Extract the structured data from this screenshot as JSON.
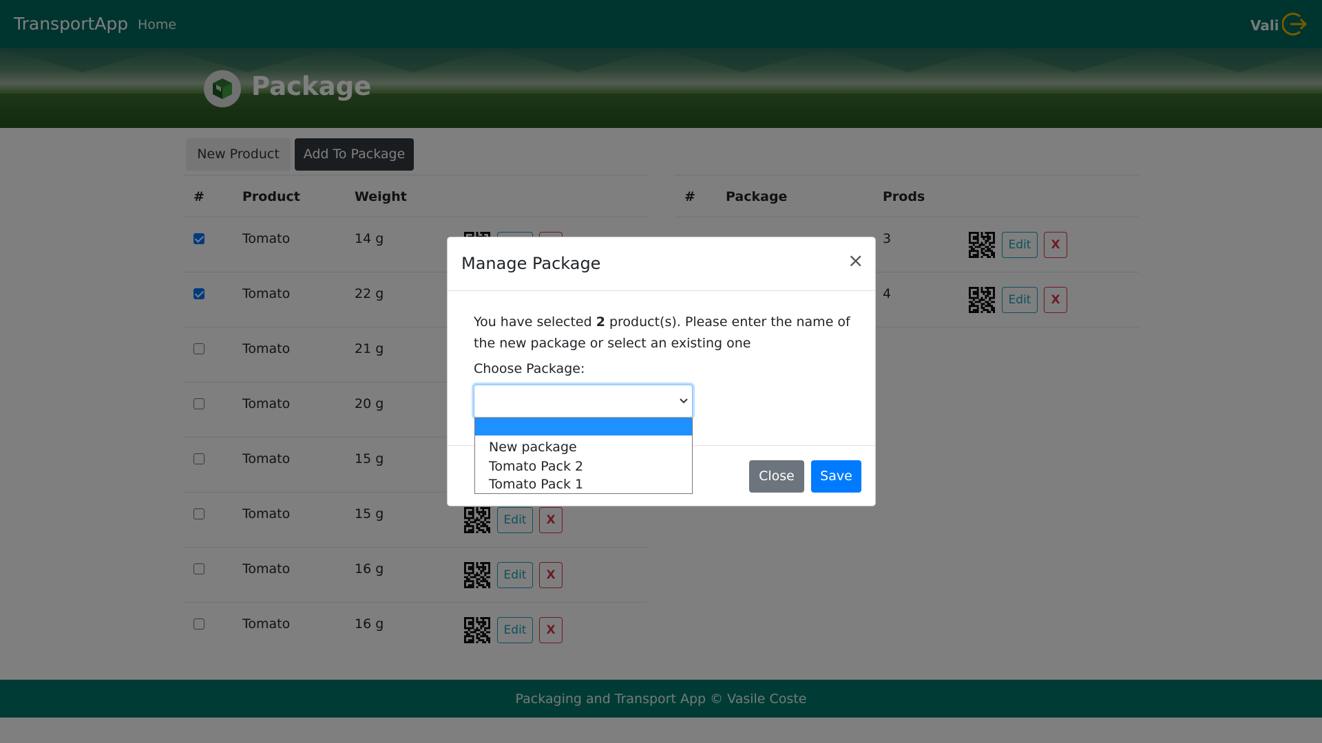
{
  "navbar": {
    "brand": "TransportApp",
    "home": "Home",
    "user": "Vali"
  },
  "hero": {
    "title": "Package"
  },
  "tabs": {
    "new_product": "New Product",
    "add_to_package": "Add To Package"
  },
  "products_table": {
    "headers": [
      "#",
      "Product",
      "Weight"
    ],
    "rows": [
      {
        "checked": true,
        "product": "Tomato",
        "weight": "14 g"
      },
      {
        "checked": true,
        "product": "Tomato",
        "weight": "22 g"
      },
      {
        "checked": false,
        "product": "Tomato",
        "weight": "21 g"
      },
      {
        "checked": false,
        "product": "Tomato",
        "weight": "20 g"
      },
      {
        "checked": false,
        "product": "Tomato",
        "weight": "15 g"
      },
      {
        "checked": false,
        "product": "Tomato",
        "weight": "15 g"
      },
      {
        "checked": false,
        "product": "Tomato",
        "weight": "16 g"
      },
      {
        "checked": false,
        "product": "Tomato",
        "weight": "16 g"
      }
    ],
    "edit_label": "Edit",
    "delete_label": "X"
  },
  "packages_table": {
    "headers": [
      "#",
      "Package",
      "Prods"
    ],
    "rows": [
      {
        "prods": "3"
      },
      {
        "prods": "4"
      }
    ],
    "edit_label": "Edit",
    "delete_label": "X"
  },
  "modal": {
    "title": "Manage Package",
    "close_symbol": "×",
    "message_pre": "You have selected ",
    "message_count": "2",
    "message_post": " product(s). Please enter the name of the new package or select an existing one",
    "choose_label": "Choose Package:",
    "selected_value": "",
    "options": [
      "",
      "New package",
      "Tomato Pack 2",
      "Tomato Pack 1"
    ],
    "close_button": "Close",
    "save_button": "Save"
  },
  "footer": {
    "text": "Packaging and Transport App © Vasile Coste"
  },
  "colors": {
    "navbar": "#00695c",
    "footer": "#00796b",
    "primary": "#007bff",
    "danger": "#dc3545",
    "info": "#17a2b8",
    "secondary": "#6c757d",
    "logout_icon": "#f0b400"
  }
}
